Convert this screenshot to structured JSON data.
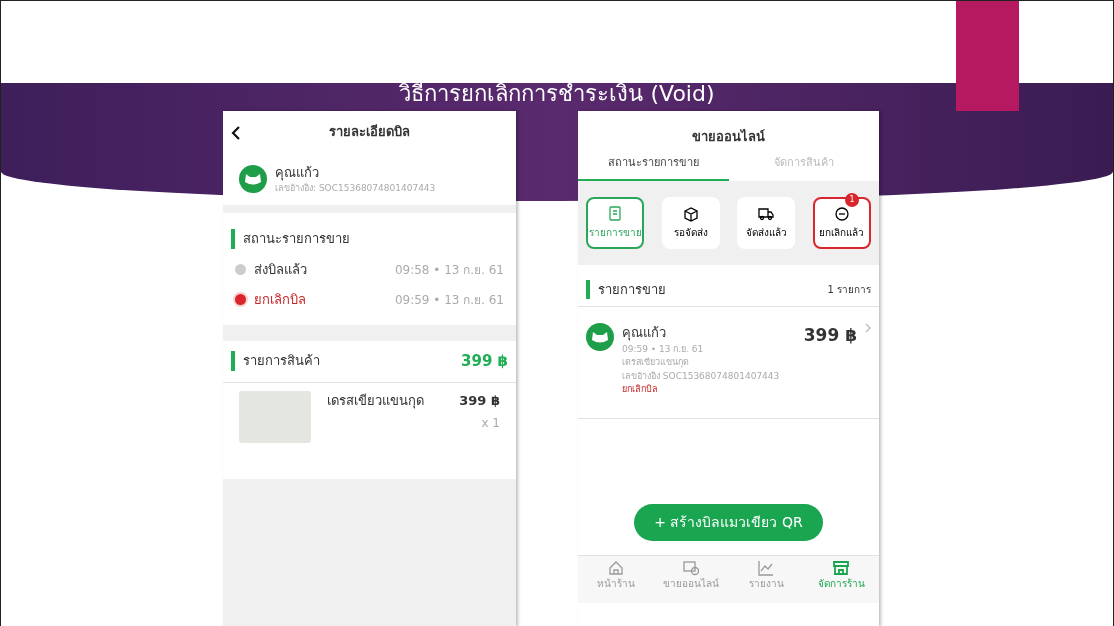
{
  "slide": {
    "title": "วิธีการยกเลิกการชำระเงิน (Void)"
  },
  "bill_detail": {
    "title": "รายละเอียดบิล",
    "customer": {
      "name": "คุณแก้ว",
      "reference": "เลขอ้างอิง: SOC15368074801407443"
    },
    "status": {
      "title": "สถานะรายการขาย",
      "steps": [
        {
          "label": "ส่งบิลแล้ว",
          "time": "09:58 • 13 ก.ย. 61",
          "current": false
        },
        {
          "label": "ยกเลิกบิล",
          "time": "09:59 • 13 ก.ย. 61",
          "current": true
        }
      ]
    },
    "products": {
      "title": "รายการสินค้า",
      "total": "399 ฿",
      "items": [
        {
          "name": "เดรสเขียวแขนกุด",
          "price": "399 ฿",
          "quantity": "x 1"
        }
      ]
    }
  },
  "online_sales": {
    "title": "ขายออนไลน์",
    "tabs": [
      {
        "label": "สถานะรายการขาย",
        "selected": true
      },
      {
        "label": "จัดการสินค้า",
        "selected": false
      }
    ],
    "filters": [
      {
        "label": "รายการขาย",
        "kind": "receipt",
        "selected": true,
        "highlighted": false
      },
      {
        "label": "รอจัดส่ง",
        "kind": "box",
        "selected": false,
        "highlighted": false
      },
      {
        "label": "จัดส่งแล้ว",
        "kind": "truck",
        "selected": false,
        "highlighted": false
      },
      {
        "label": "ยกเลิกแล้ว",
        "kind": "cancel",
        "selected": false,
        "highlighted": true,
        "badge": "1"
      }
    ],
    "section": {
      "title": "รายการขาย",
      "count": "1 รายการ"
    },
    "orders": [
      {
        "name": "คุณแก้ว",
        "time": "09:59 • 13 ก.ย. 61",
        "product": "เดรสเขียวแขนกุด",
        "reference": "เลขอ้างอิง SOC15368074801407443",
        "status": "ยกเลิกบิล",
        "amount": "399 ฿"
      }
    ],
    "create_button": "+ สร้างบิลแมวเขียว QR",
    "nav": [
      {
        "label": "หน้าร้าน",
        "kind": "home",
        "selected": false
      },
      {
        "label": "ขายออนไลน์",
        "kind": "chat",
        "selected": false
      },
      {
        "label": "รายงาน",
        "kind": "chart",
        "selected": false
      },
      {
        "label": "จัดการร้าน",
        "kind": "store",
        "selected": true
      }
    ]
  }
}
